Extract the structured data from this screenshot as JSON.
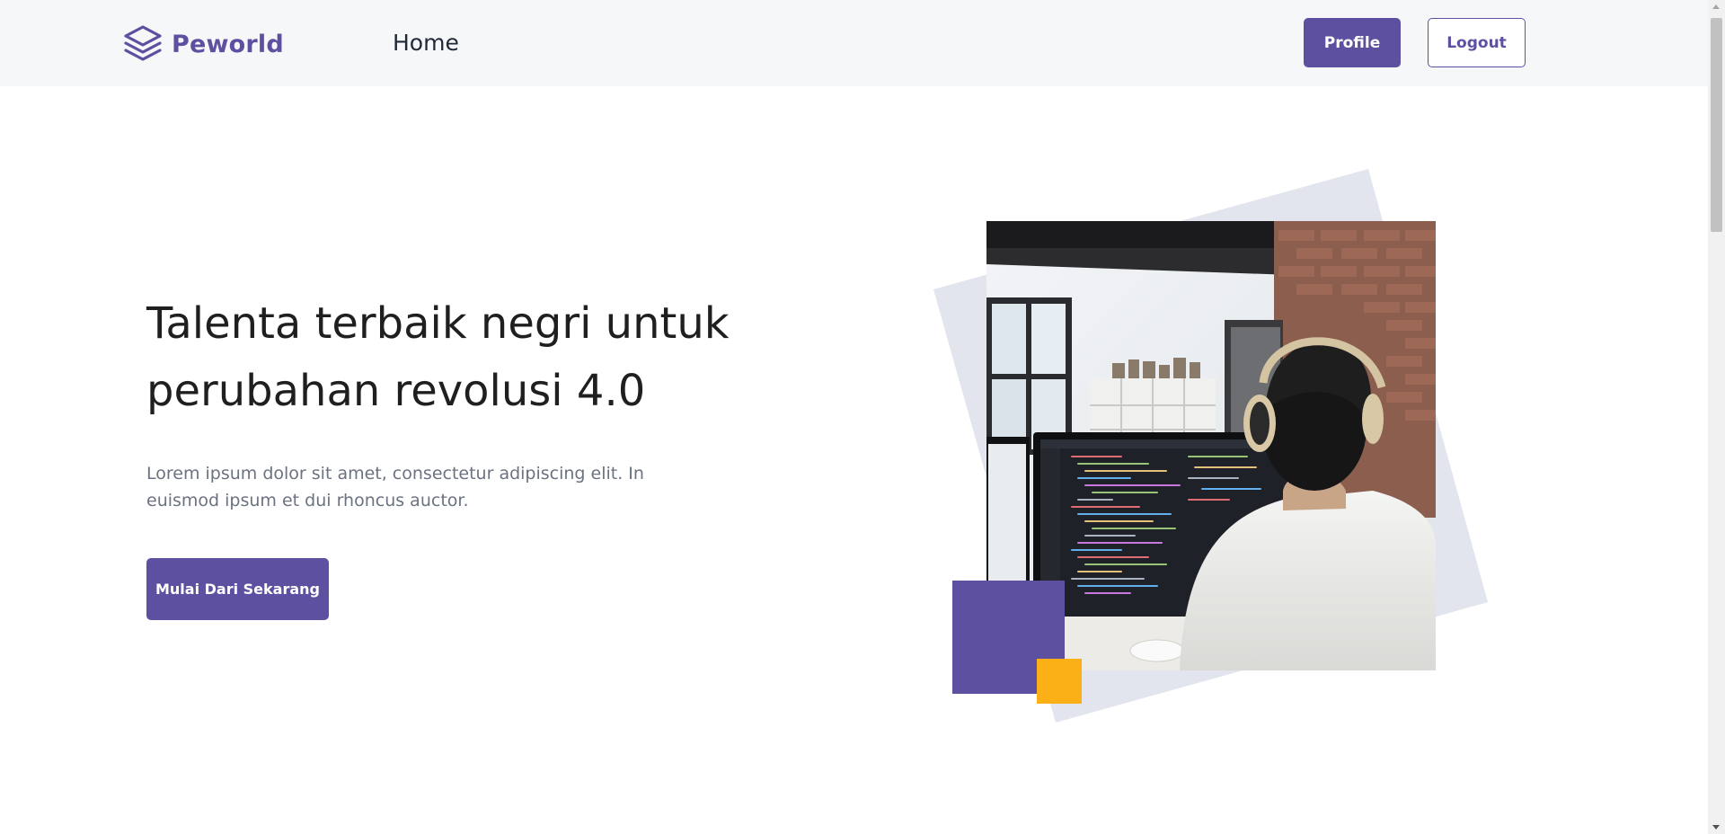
{
  "navbar": {
    "brand": "Peworld",
    "links": {
      "home": "Home"
    },
    "buttons": {
      "profile": "Profile",
      "logout": "Logout"
    }
  },
  "hero": {
    "title": "Talenta terbaik negri untuk perubahan revolusi 4.0",
    "description": "Lorem ipsum dolor sit amet, consectetur adipiscing elit. In euismod ipsum et dui rhoncus auctor.",
    "cta": "Mulai Dari Sekarang"
  },
  "icons": {
    "logo": "layers-stack-icon",
    "scroll_up": "arrow-up-icon",
    "scroll_down": "arrow-down-icon"
  },
  "colors": {
    "primary": "#5e50a1",
    "accent": "#fbb017",
    "nav_bg": "#f6f7f8",
    "decor_bg": "#e2e4ee"
  }
}
